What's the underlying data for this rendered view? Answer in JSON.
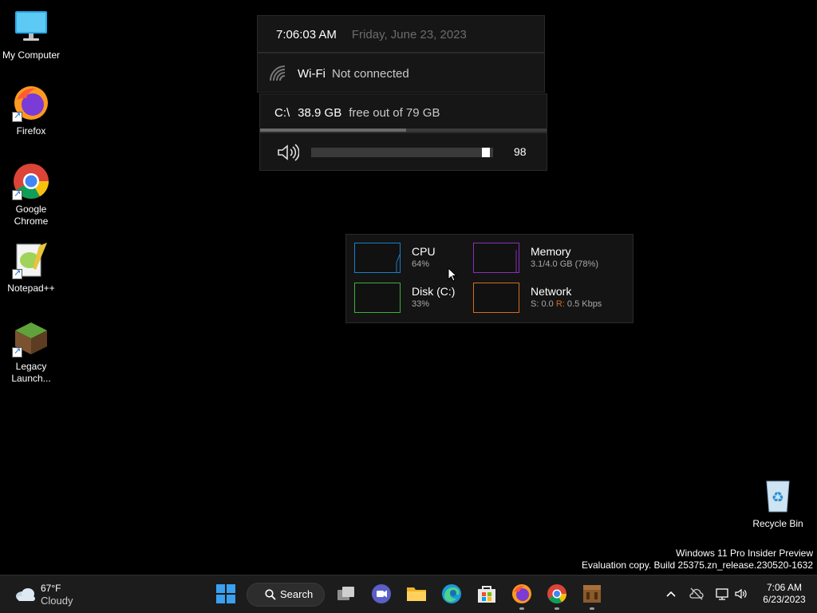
{
  "desktop": {
    "icons": [
      {
        "label_line1": "My Computer",
        "label_line2": ""
      },
      {
        "label_line1": "Firefox",
        "label_line2": ""
      },
      {
        "label_line1": "Google",
        "label_line2": "Chrome"
      },
      {
        "label_line1": "Notepad++",
        "label_line2": ""
      },
      {
        "label_line1": "Legacy",
        "label_line2": "Launch..."
      }
    ],
    "recycle_bin": "Recycle Bin",
    "watermark": {
      "line1": "Windows 11 Pro Insider Preview",
      "line2": "Evaluation copy. Build 25375.zn_release.230520-1632"
    }
  },
  "widgets": {
    "clock": {
      "time": "7:06:03 AM",
      "date": "Friday, June 23, 2023"
    },
    "wifi": {
      "label": "Wi-Fi",
      "status": "Not connected"
    },
    "disk": {
      "drive": "C:\\",
      "free": "38.9 GB",
      "detail": "free out of 79 GB",
      "used_fraction": 0.51
    },
    "volume": {
      "value": "98",
      "level": 0.98
    }
  },
  "stats": {
    "cpu": {
      "name": "CPU",
      "value": "64%"
    },
    "memory": {
      "name": "Memory",
      "value": "3.1/4.0 GB (78%)"
    },
    "disk": {
      "name": "Disk (C:)",
      "value": "33%"
    },
    "network": {
      "name": "Network",
      "send_label": "S:",
      "send_value": "0.0",
      "recv_label": "R:",
      "recv_value": "0.5 Kbps"
    }
  },
  "colors": {
    "cpu": "#1c7fc4",
    "memory": "#8a2fb8",
    "disk": "#3fae3a",
    "network": "#d86b1e"
  },
  "taskbar": {
    "weather": {
      "temp": "67°F",
      "condition": "Cloudy"
    },
    "search_label": "Search",
    "clock": {
      "time": "7:06 AM",
      "date": "6/23/2023"
    }
  }
}
